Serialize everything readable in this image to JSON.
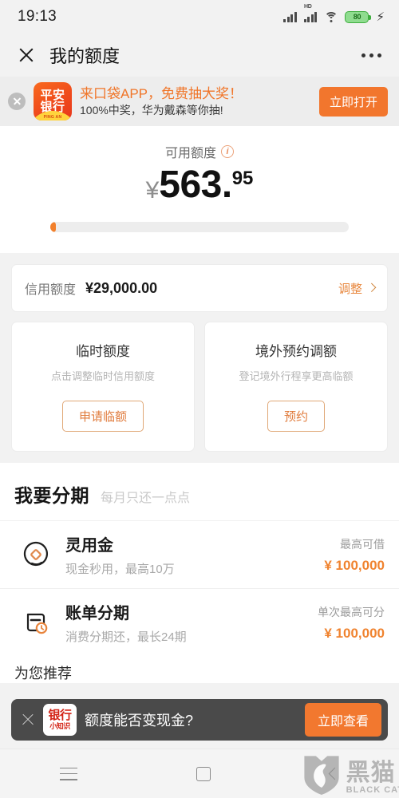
{
  "status_bar": {
    "time": "19:13",
    "hd_label": "HD",
    "battery_level": "80",
    "icons": [
      "signal-icon",
      "signal-hd-icon",
      "wifi-icon",
      "battery-icon",
      "charging-bolt-icon"
    ]
  },
  "header": {
    "title": "我的额度",
    "close_icon": "close-icon",
    "menu_icon": "more-options-icon"
  },
  "ad_banner": {
    "close_icon": "close-icon",
    "logo_line1": "平安",
    "logo_line2": "银行",
    "logo_en": "PING AN",
    "title": "来口袋APP，免费抽大奖！",
    "subtitle": "100%中奖，华为戴森等你抽!",
    "button_label": "立即打开"
  },
  "balance": {
    "label": "可用额度",
    "info_icon": "info-icon",
    "currency": "¥",
    "integer": "563.",
    "decimal": "95",
    "progress_percent": 2
  },
  "credit_limit": {
    "label": "信用额度",
    "value": "¥29,000.00",
    "action_label": "调整"
  },
  "quota_cards": [
    {
      "title": "临时额度",
      "subtitle": "点击调整临时信用额度",
      "button_label": "申请临额"
    },
    {
      "title": "境外预约调额",
      "subtitle": "登记境外行程享更高临额",
      "button_label": "预约"
    }
  ],
  "installment": {
    "section_title": "我要分期",
    "section_subtitle": "每月只还一点点",
    "items": [
      {
        "icon": "cash-bubble-icon",
        "title": "灵用金",
        "subtitle": "现金秒用，最高10万",
        "caption": "最高可借",
        "amount": "¥ 100,000"
      },
      {
        "icon": "bill-clock-icon",
        "title": "账单分期",
        "subtitle": "消费分期还，最长24期",
        "caption": "单次最高可分",
        "amount": "¥ 100,000"
      }
    ],
    "more_label": "为您推荐"
  },
  "toast": {
    "close_icon": "close-icon",
    "badge_line1": "银行",
    "badge_line2": "小知识",
    "message": "额度能否变现金?",
    "button_label": "立即查看"
  },
  "nav_bar": {
    "recent_icon": "recent-apps-icon",
    "home_icon": "home-icon",
    "back_icon": "back-icon"
  },
  "watermark": {
    "cn": "黑猫",
    "en": "BLACK CAT"
  },
  "colors": {
    "accent_orange": "#f2782f",
    "link_orange": "#e8883f",
    "page_bg": "#f2f2f2",
    "toast_bg": "#4a4a4a"
  }
}
